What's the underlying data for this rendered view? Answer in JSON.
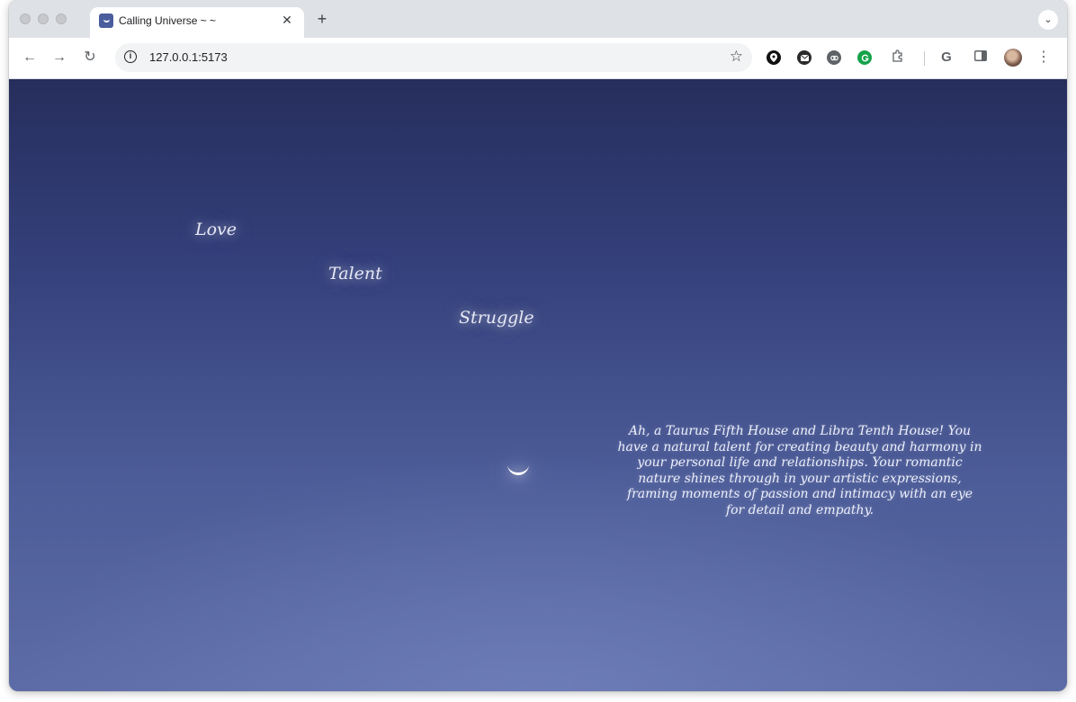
{
  "browser": {
    "tab": {
      "title": "Calling Universe ~ ~",
      "close": "✕"
    },
    "new_tab": "+",
    "tab_search": "⌄",
    "url": "127.0.0.1:5173",
    "toolbar": {
      "back": "←",
      "forward": "→",
      "reload": "↻",
      "info": "i",
      "bookmark": "☆",
      "extensions_icon": "puzzle-icon",
      "google": "G",
      "menu": "⋮"
    }
  },
  "page": {
    "words": [
      "Love",
      "Talent",
      "Struggle"
    ],
    "reading": "Ah, a Taurus Fifth House and Libra Tenth House! You have a natural talent for creating beauty and harmony in your personal life and relationships. Your romantic nature shines through in your artistic expressions, framing moments of passion and intimacy with an eye for detail and empathy."
  },
  "colors": {
    "sky_top": "#262e5d",
    "sky_bottom": "#5d6ca6",
    "text": "#e6e8f5"
  }
}
